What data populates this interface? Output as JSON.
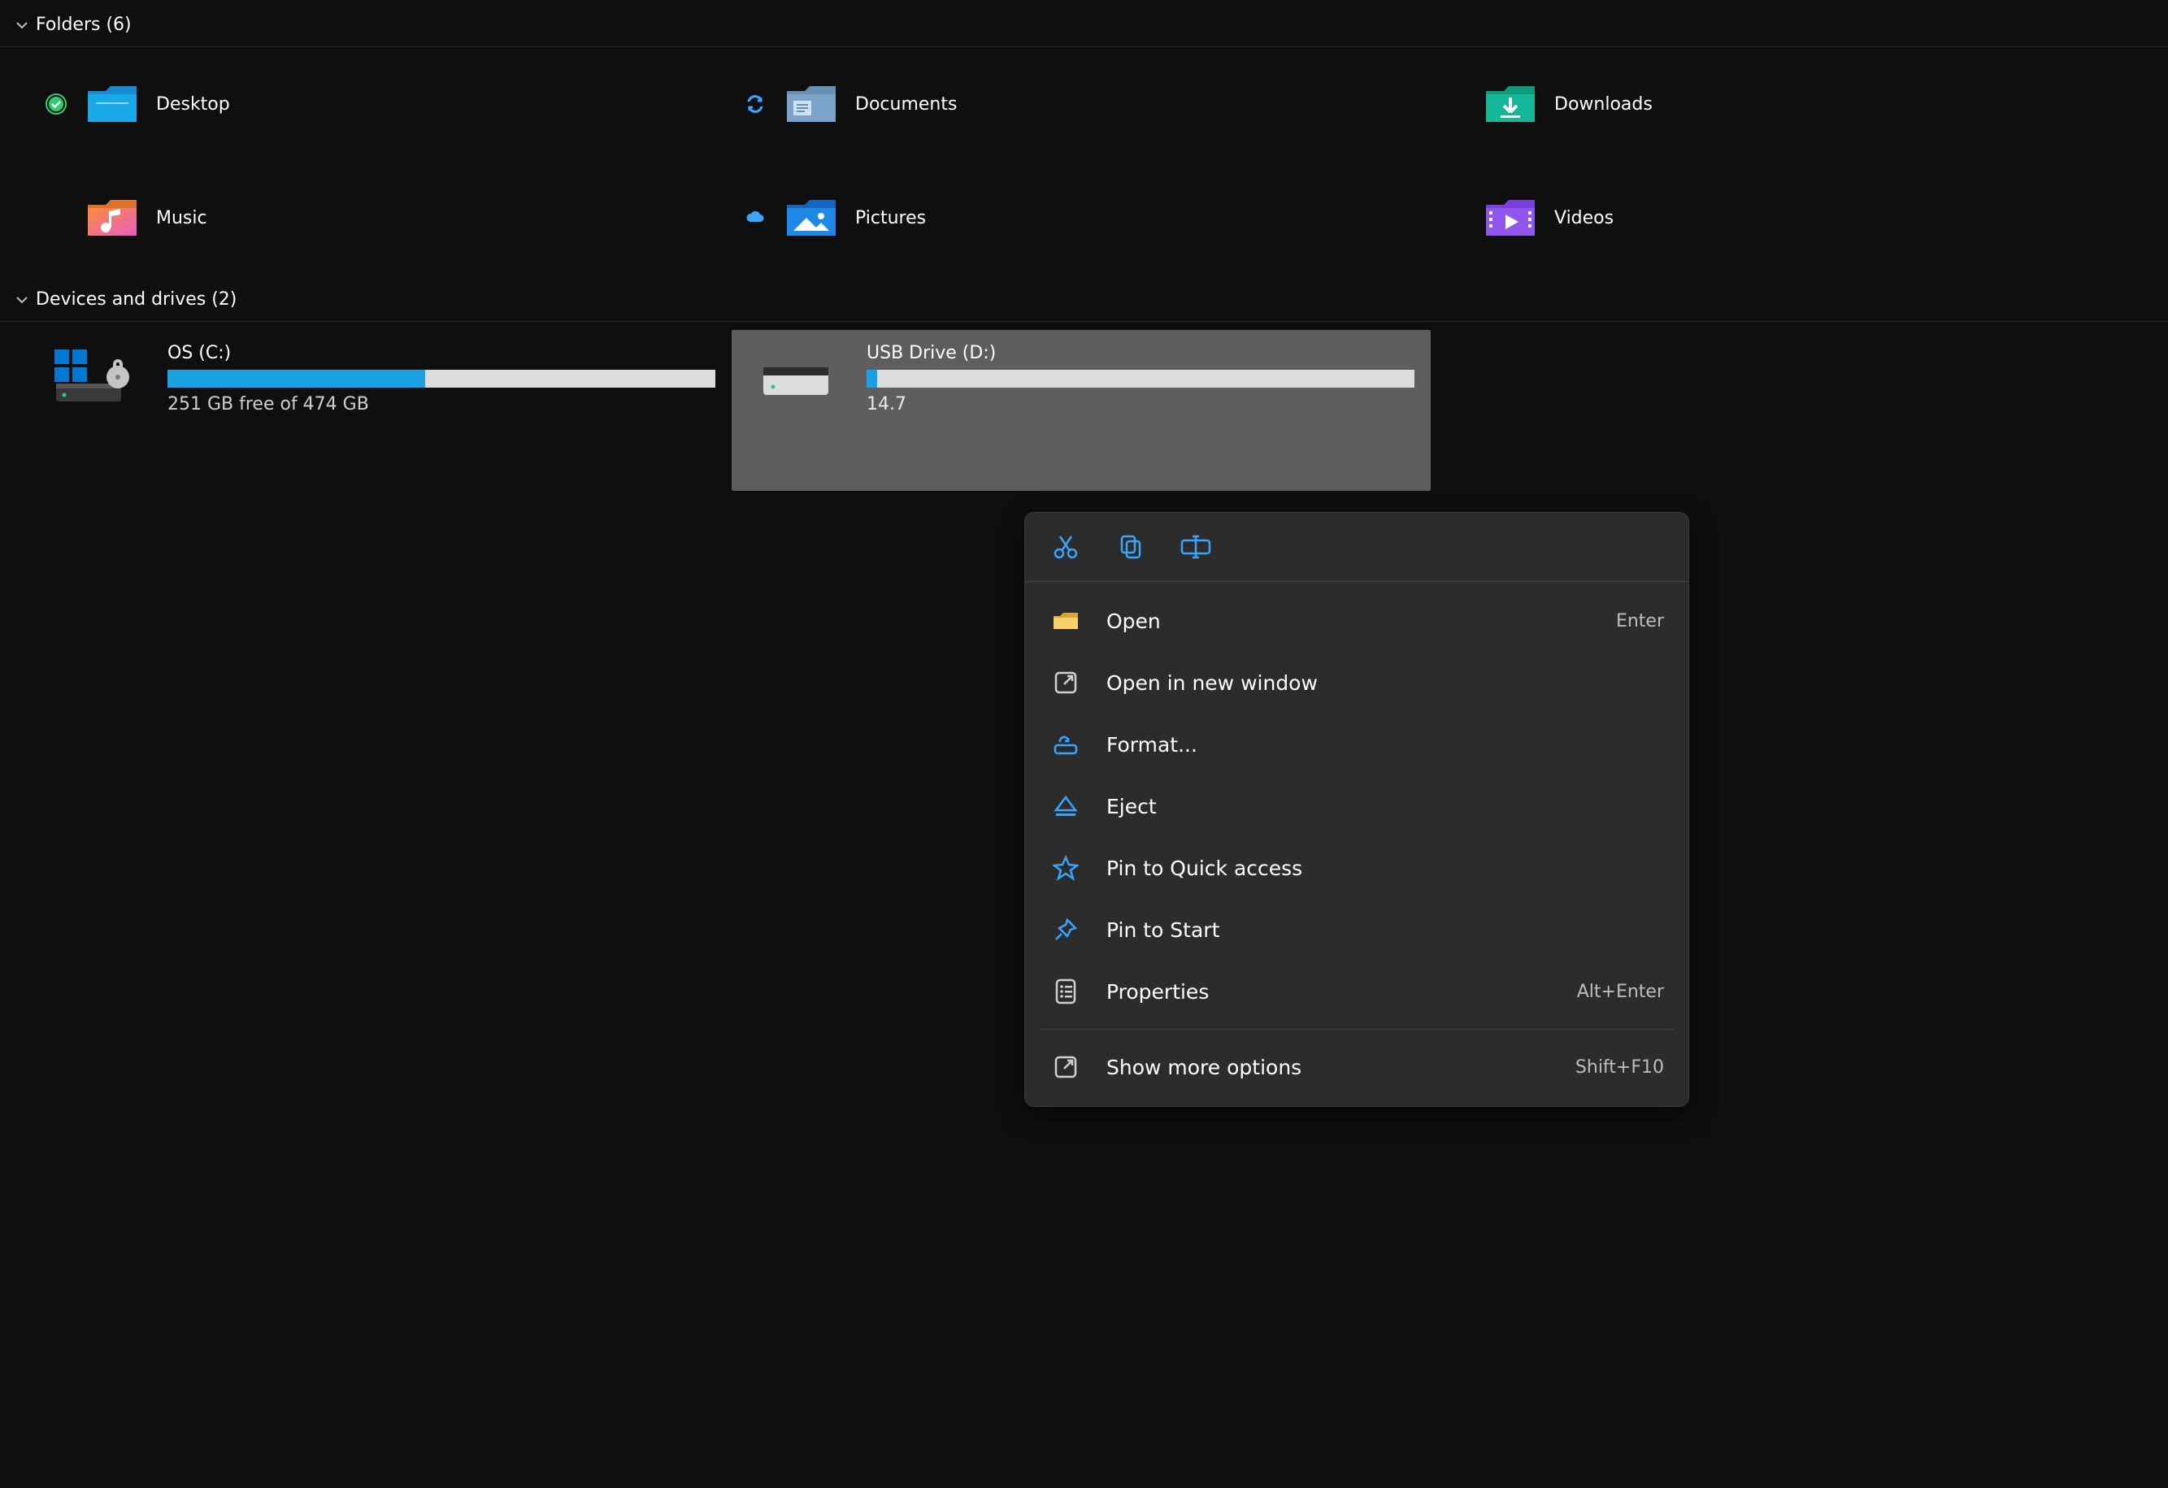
{
  "sections": {
    "folders": {
      "title": "Folders (6)",
      "items": [
        {
          "label": "Desktop",
          "status": "synced",
          "icon": "desktop-folder"
        },
        {
          "label": "Documents",
          "status": "sync",
          "icon": "documents-folder"
        },
        {
          "label": "Downloads",
          "status": "",
          "icon": "downloads-folder"
        },
        {
          "label": "Music",
          "status": "",
          "icon": "music-folder"
        },
        {
          "label": "Pictures",
          "status": "cloud",
          "icon": "pictures-folder"
        },
        {
          "label": "Videos",
          "status": "",
          "icon": "videos-folder"
        }
      ]
    },
    "drives": {
      "title": "Devices and drives (2)",
      "items": [
        {
          "name": "OS (C:)",
          "free": "251 GB free of 474 GB",
          "fill_pct": 47,
          "icon": "os-drive",
          "selected": false
        },
        {
          "name": "USB Drive (D:)",
          "free": "14.7",
          "fill_pct": 2,
          "icon": "usb-drive",
          "selected": true
        }
      ]
    }
  },
  "context_menu": {
    "toolbar": [
      "cut",
      "copy",
      "rename"
    ],
    "items": [
      {
        "icon": "folder",
        "label": "Open",
        "shortcut": "Enter"
      },
      {
        "icon": "new-window",
        "label": "Open in new window",
        "shortcut": ""
      },
      {
        "icon": "format",
        "label": "Format...",
        "shortcut": ""
      },
      {
        "icon": "eject",
        "label": "Eject",
        "shortcut": ""
      },
      {
        "icon": "pin-star",
        "label": "Pin to Quick access",
        "shortcut": ""
      },
      {
        "icon": "pin",
        "label": "Pin to Start",
        "shortcut": ""
      },
      {
        "icon": "properties",
        "label": "Properties",
        "shortcut": "Alt+Enter"
      },
      {
        "sep": true
      },
      {
        "icon": "more",
        "label": "Show more options",
        "shortcut": "Shift+F10"
      }
    ]
  },
  "colors": {
    "accent": "#1ba1e2",
    "blue": "#3aa5ff"
  }
}
